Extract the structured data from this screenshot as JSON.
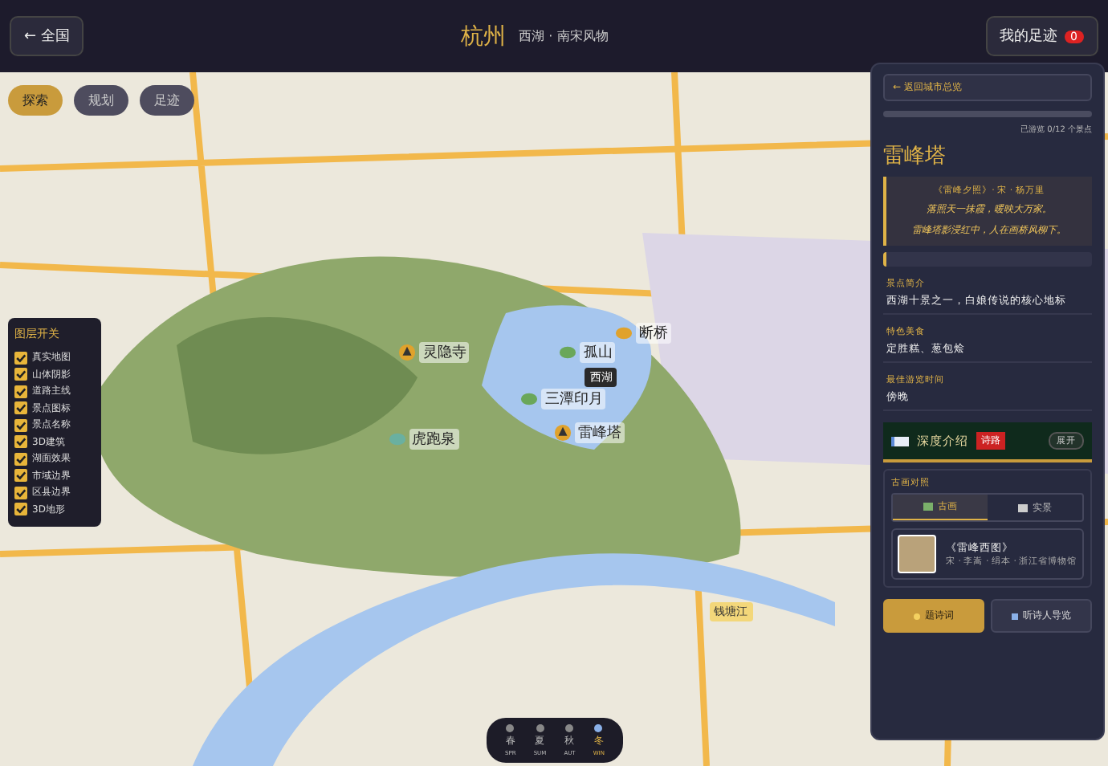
{
  "top_bar": {
    "back": "← 全国",
    "city": "杭州",
    "subtitle": "西湖 · 南宋风物",
    "footprints": {
      "label": "我的足迹",
      "count": "0"
    }
  },
  "mode_tabs": [
    {
      "label": "探索",
      "selected": true
    },
    {
      "label": "规划",
      "selected": false
    },
    {
      "label": "足迹",
      "selected": false
    }
  ],
  "markers": [
    {
      "label": "灵隐寺",
      "kind": "temple"
    },
    {
      "label": "断桥",
      "kind": "spot"
    },
    {
      "label": "孤山",
      "kind": "hill"
    },
    {
      "label": "西湖",
      "kind": "tag"
    },
    {
      "label": "三潭印月",
      "kind": "hill"
    },
    {
      "label": "雷峰塔",
      "kind": "temple"
    },
    {
      "label": "虎跑泉",
      "kind": "spring"
    },
    {
      "label": "钱塘江",
      "kind": "river"
    }
  ],
  "layers": {
    "title": "图层开关",
    "items": [
      {
        "label": "真实地图",
        "checked": true
      },
      {
        "label": "山体阴影",
        "checked": true
      },
      {
        "label": "道路主线",
        "checked": true
      },
      {
        "label": "景点图标",
        "checked": true
      },
      {
        "label": "景点名称",
        "checked": true
      },
      {
        "label": "3D建筑",
        "checked": true
      },
      {
        "label": "湖面效果",
        "checked": true
      },
      {
        "label": "市域边界",
        "checked": true
      },
      {
        "label": "区县边界",
        "checked": true
      },
      {
        "label": "3D地形",
        "checked": true
      }
    ]
  },
  "detail": {
    "back": "← 返回城市总览",
    "progress": {
      "level": 0,
      "text": "已游览 0/12 个景点"
    },
    "title": "雷峰塔",
    "poem": {
      "source": "《雷峰夕照》· 宋 · 杨万里",
      "lines": [
        "落照天一抹霞，暖映大万家。",
        "雷峰塔影浸红中，人在画桥风柳下。"
      ]
    },
    "facts": [
      {
        "label": "景点简介",
        "value": "西湖十景之一，白娘传说的核心地标"
      },
      {
        "label": "特色美食",
        "value": "定胜糕、葱包烩"
      },
      {
        "label": "最佳游览时间",
        "value": "傍晚"
      }
    ],
    "deep": {
      "title": "深度介绍",
      "badge": "诗路",
      "button": "展开"
    },
    "painting": {
      "title": "古画对照",
      "tabs": [
        {
          "label": "古画",
          "selected": true
        },
        {
          "label": "实景",
          "selected": false
        }
      ],
      "name": "《雷峰西图》",
      "meta": "宋 · 李嵩 · 绢本 · 浙江省博物馆"
    },
    "actions": [
      {
        "label": "题诗词",
        "kind": "primary"
      },
      {
        "label": "听诗人导览",
        "kind": "secondary"
      }
    ]
  },
  "seasons": [
    {
      "label": "春",
      "sub": "SPR",
      "selected": false
    },
    {
      "label": "夏",
      "sub": "SUM",
      "selected": false
    },
    {
      "label": "秋",
      "sub": "AUT",
      "selected": false
    },
    {
      "label": "冬",
      "sub": "WIN",
      "selected": true
    }
  ]
}
